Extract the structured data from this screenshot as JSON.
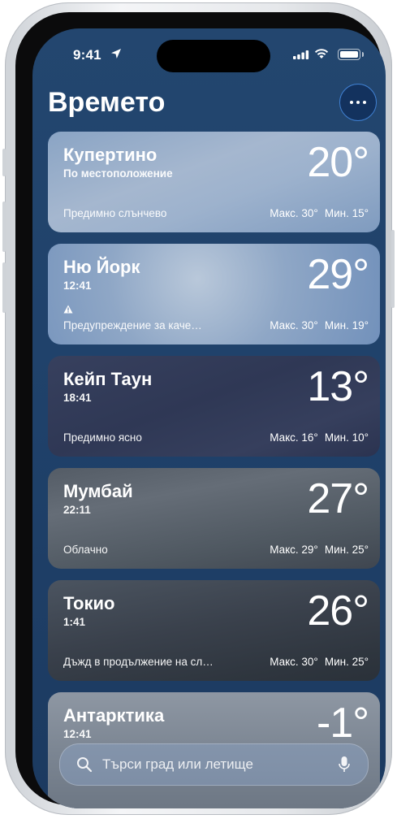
{
  "status_bar": {
    "time": "9:41"
  },
  "header": {
    "title": "Времето"
  },
  "cities": [
    {
      "name": "Купертино",
      "subtitle": "По местоположение",
      "temp": "20°",
      "condition": "Предимно слънчево",
      "high": "Макс. 30°",
      "low": "Мин. 15°"
    },
    {
      "name": "Ню Йорк",
      "subtitle": "12:41",
      "temp": "29°",
      "condition": "Предупреждение за каче…",
      "high": "Макс. 30°",
      "low": "Мин. 19°"
    },
    {
      "name": "Кейп Таун",
      "subtitle": "18:41",
      "temp": "13°",
      "condition": "Предимно ясно",
      "high": "Макс. 16°",
      "low": "Мин. 10°"
    },
    {
      "name": "Мумбай",
      "subtitle": "22:11",
      "temp": "27°",
      "condition": "Облачно",
      "high": "Макс. 29°",
      "low": "Мин. 25°"
    },
    {
      "name": "Токио",
      "subtitle": "1:41",
      "temp": "26°",
      "condition": "Дъжд в продължение на сл…",
      "high": "Макс. 30°",
      "low": "Мин. 25°"
    },
    {
      "name": "Антарктика",
      "subtitle": "12:41",
      "temp": "-1°"
    }
  ],
  "search": {
    "placeholder": "Търси град или летище"
  },
  "icons": {
    "more": "ellipsis-icon",
    "search": "magnifier-icon",
    "mic": "microphone-icon",
    "warning": "warning-triangle-icon",
    "location": "location-arrow-icon"
  }
}
